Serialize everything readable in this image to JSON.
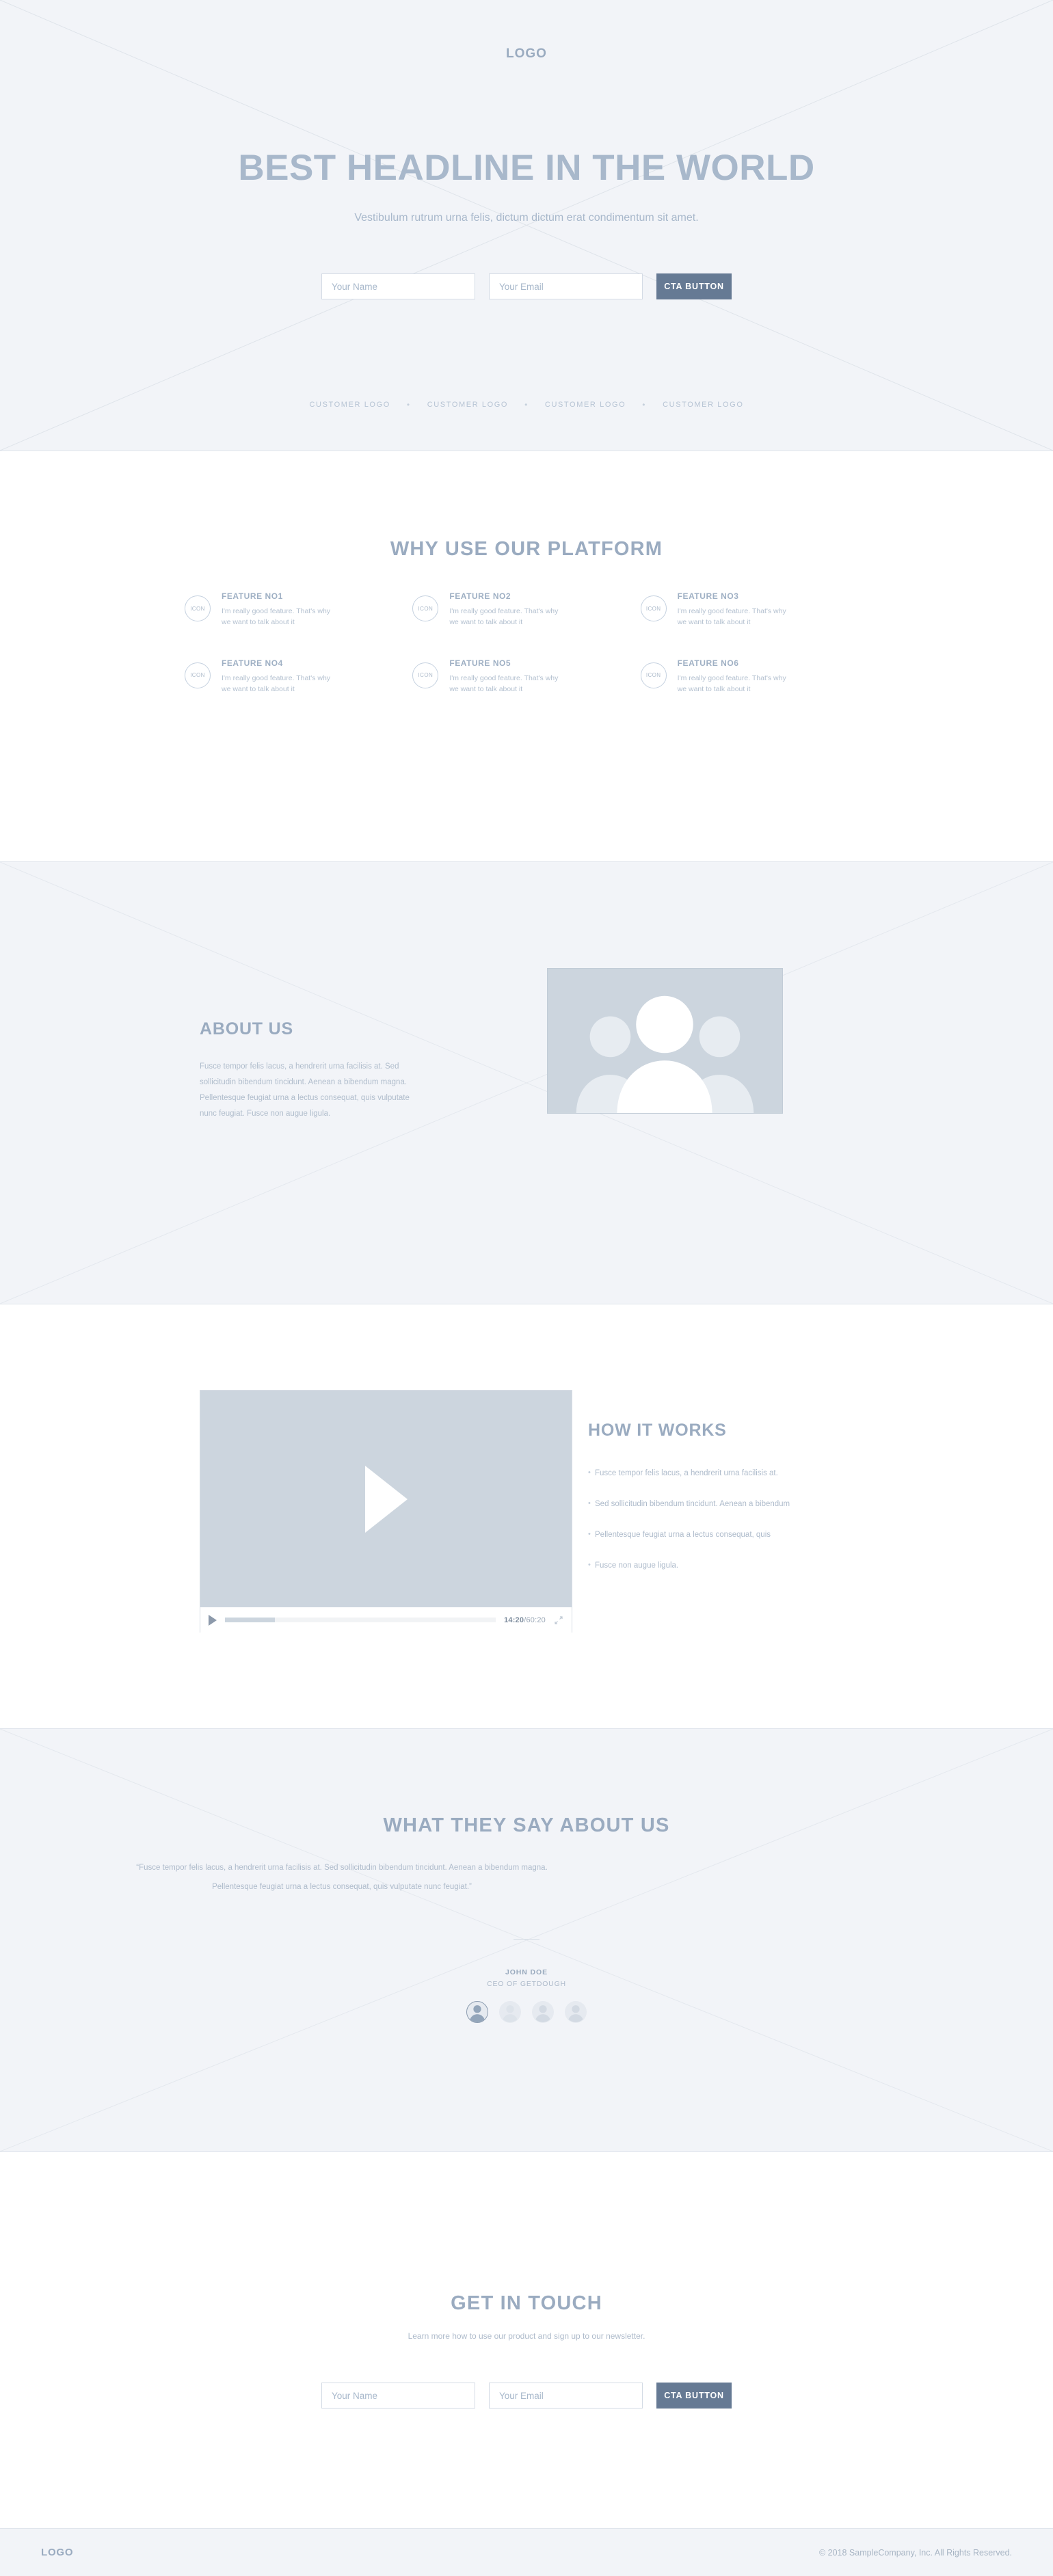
{
  "colors": {
    "page_bg": "#ffffff",
    "section_bg": "#f2f4f8",
    "heading": "#9aabc0",
    "body_text": "#aebbcb",
    "cta_bg": "#667a94",
    "placeholder_img": "#ccd5de",
    "border": "#d4dbe5"
  },
  "hero": {
    "logo": "LOGO",
    "headline": "BEST HEADLINE IN THE WORLD",
    "subheadline": "Vestibulum rutrum urna felis, dictum dictum erat condimentum sit amet.",
    "form": {
      "name_placeholder": "Your Name",
      "email_placeholder": "Your Email",
      "cta_label": "CTA BUTTON"
    },
    "customer_logos": [
      "CUSTOMER LOGO",
      "CUSTOMER LOGO",
      "CUSTOMER LOGO",
      "CUSTOMER LOGO"
    ],
    "separator": "•"
  },
  "features": {
    "title": "WHY USE OUR PLATFORM",
    "icon_label": "ICON",
    "items": [
      {
        "title": "FEATURE NO1",
        "desc": "I'm really good feature. That's why we want to talk about it"
      },
      {
        "title": "FEATURE NO2",
        "desc": "I'm really good feature. That's why we want to talk about it"
      },
      {
        "title": "FEATURE NO3",
        "desc": "I'm really good feature. That's why we want to talk about it"
      },
      {
        "title": "FEATURE NO4",
        "desc": "I'm really good feature. That's why we want to talk about it"
      },
      {
        "title": "FEATURE NO5",
        "desc": "I'm really good feature. That's why we want to talk about it"
      },
      {
        "title": "FEATURE NO6",
        "desc": "I'm really good feature. That's why we want to talk about it"
      }
    ]
  },
  "about": {
    "title": "ABOUT US",
    "body": "Fusce tempor felis lacus, a hendrerit urna facilisis at. Sed sollicitudin bibendum tincidunt. Aenean a bibendum magna. Pellentesque feugiat urna a lectus consequat, quis vulputate nunc feugiat. Fusce non augue ligula.",
    "image_alt": "team-photo-placeholder"
  },
  "how_it_works": {
    "title": "HOW IT WORKS",
    "bullets": [
      "Fusce tempor felis lacus, a hendrerit urna facilisis at.",
      "Sed sollicitudin bibendum tincidunt. Aenean a bibendum",
      "Pellentesque feugiat urna a lectus consequat, quis",
      "Fusce non augue ligula."
    ],
    "video": {
      "current_time": "14:20",
      "total_time": "60:20",
      "time_separator": "/",
      "progress_percent": 18.5
    }
  },
  "testimonial": {
    "title": "WHAT THEY SAY ABOUT US",
    "quote": "“Fusce tempor felis lacus, a hendrerit urna facilisis at. Sed sollicitudin bibendum tincidunt. Aenean a bibendum magna. Pellentesque feugiat urna a lectus consequat, quis vulputate nunc feugiat.”",
    "author_name": "JOHN DOE",
    "author_role": "CEO OF GETDOUGH",
    "avatar_count": 4,
    "active_avatar_index": 0
  },
  "get_in_touch": {
    "title": "GET IN TOUCH",
    "subtitle": "Learn more how to use our product and sign up to our newsletter.",
    "form": {
      "name_placeholder": "Your Name",
      "email_placeholder": "Your Email",
      "cta_label": "CTA BUTTON"
    }
  },
  "footer": {
    "logo": "LOGO",
    "copyright": "© 2018 SampleCompany, Inc. All Rights Reserved."
  }
}
